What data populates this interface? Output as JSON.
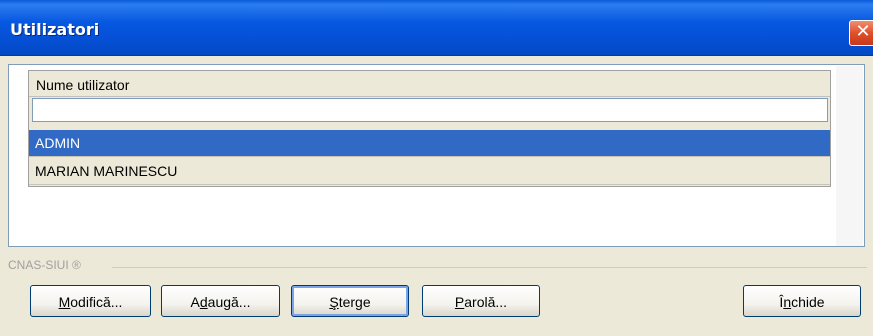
{
  "window": {
    "title": "Utilizatori",
    "close_label": "✕"
  },
  "grid": {
    "column_header": "Nume utilizator",
    "filter_value": "",
    "rows": [
      {
        "name": "ADMIN",
        "selected": true
      },
      {
        "name": "MARIAN MARINESCU",
        "selected": false
      }
    ]
  },
  "footer": {
    "group_label": "CNAS-SIUI ®"
  },
  "buttons": {
    "modify": {
      "pre": "",
      "key": "M",
      "post": "odifică..."
    },
    "add": {
      "pre": "A",
      "key": "d",
      "post": "augă..."
    },
    "delete": {
      "pre": "",
      "key": "Ş",
      "post": "terge"
    },
    "password": {
      "pre": "",
      "key": "P",
      "post": "arolă..."
    },
    "close": {
      "pre": "Î",
      "key": "n",
      "post": "chide"
    }
  },
  "colors": {
    "title_bar": "#0758e0",
    "selection": "#316ac5",
    "dialog_bg": "#ece9d8"
  }
}
